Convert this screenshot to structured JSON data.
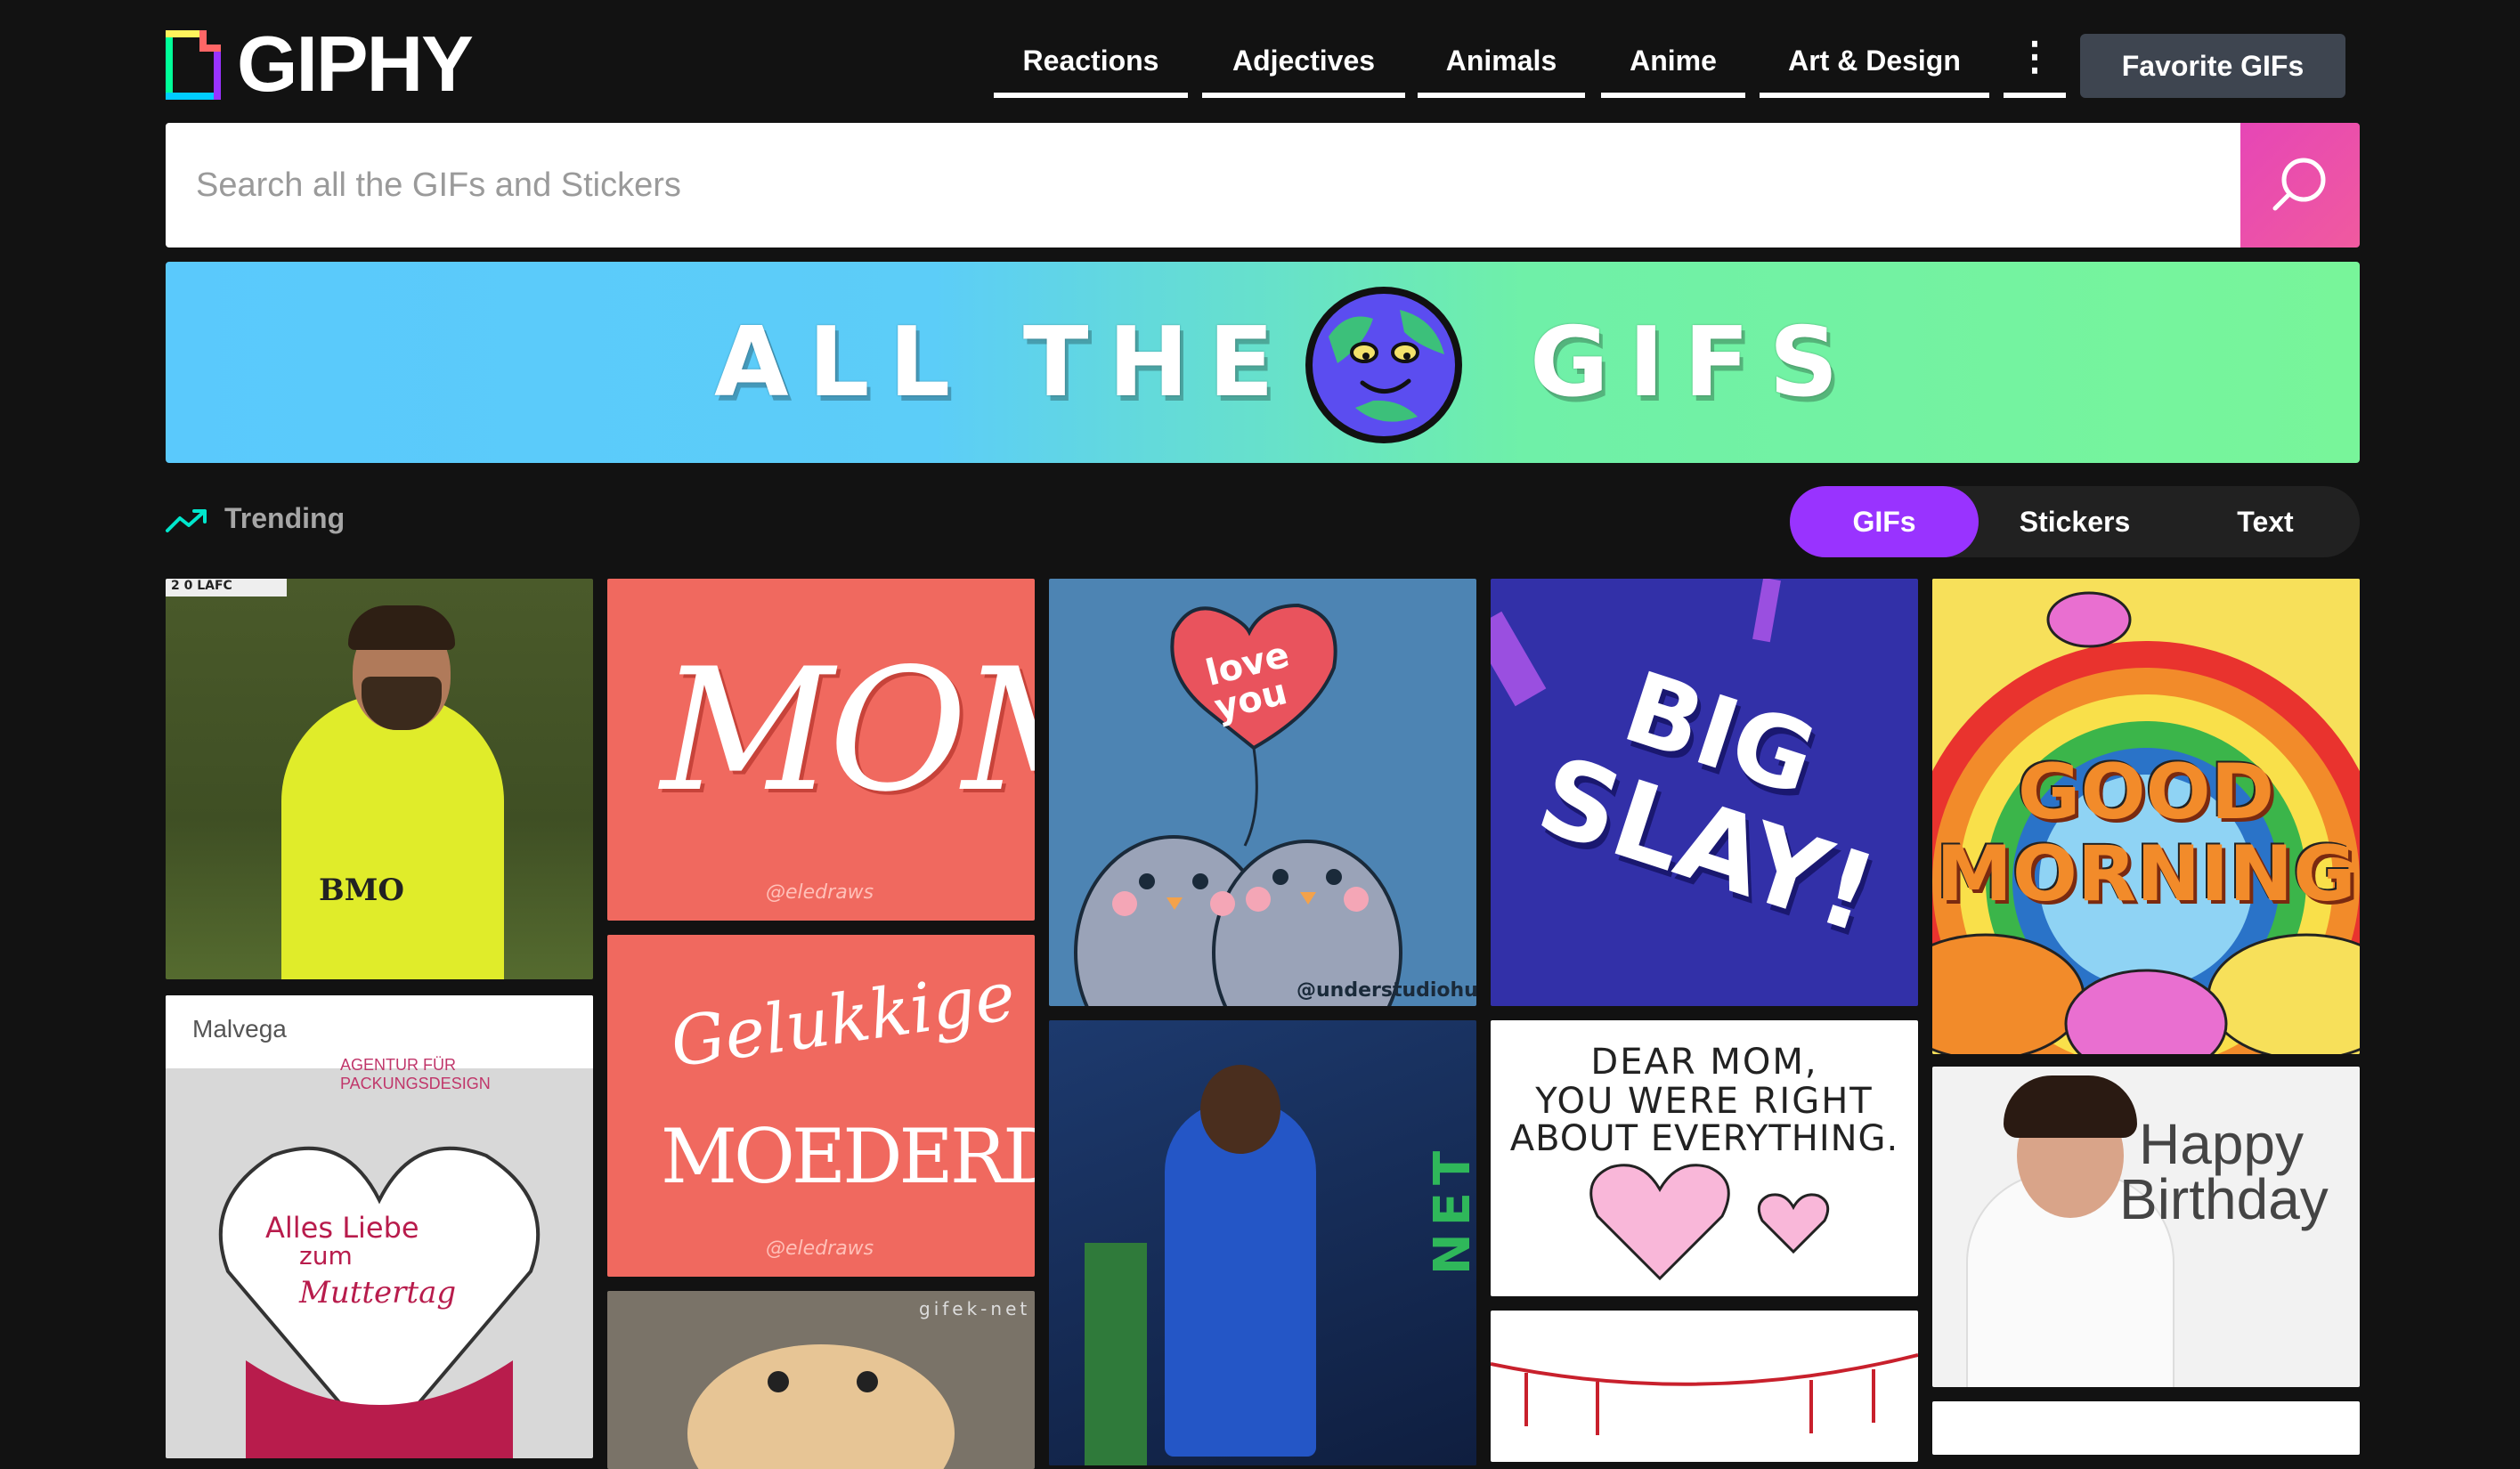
{
  "header": {
    "logo_text": "GIPHY",
    "nav": [
      "Reactions",
      "Adjectives",
      "Animals",
      "Anime",
      "Art & Design"
    ],
    "more_glyph": "⋮",
    "favorite_button": "Favorite GIFs"
  },
  "search": {
    "placeholder": "Search all the GIFs and Stickers"
  },
  "banner": {
    "left": "ALL THE",
    "right": "GIFS"
  },
  "trending": {
    "label": "Trending"
  },
  "tabs": {
    "items": [
      "GIFs",
      "Stickers",
      "Text"
    ],
    "active": "GIFs"
  },
  "tiles": {
    "soccer1": {
      "score": "2 0 LAFC",
      "sponsor": "BMO"
    },
    "mom": {
      "title": "MOM",
      "credit": "@eledraws"
    },
    "loveyou": {
      "balloon": "love you",
      "credit": "@understudiohub"
    },
    "bigslay": {
      "line1": "BIG",
      "line2": "SLAY!"
    },
    "goodmorning": {
      "line1": "GOOD",
      "line2": "MORNING"
    },
    "malvega": {
      "brand": "Malvega",
      "tagline": "AGENTUR FÜR PACKUNGSDESIGN",
      "line1": "Alles Liebe",
      "line2": "zum",
      "line3": "Muttertag"
    },
    "moederdag": {
      "line1": "Gelukkige",
      "line2": "MOEDERDAG!",
      "credit": "@eledraws"
    },
    "dearmom": {
      "line1": "DEAR MOM,",
      "line2": "YOU WERE RIGHT",
      "line3": "ABOUT EVERYTHING."
    },
    "birthday": {
      "line1": "Happy",
      "line2": "Birthday"
    },
    "hamster": {
      "watermark": "gifek-net"
    },
    "soccer2": {
      "jersey_text": "NET"
    }
  },
  "colors": {
    "accent_purple": "#9933ff",
    "search_pink": "#e646b6",
    "background": "#121212"
  }
}
